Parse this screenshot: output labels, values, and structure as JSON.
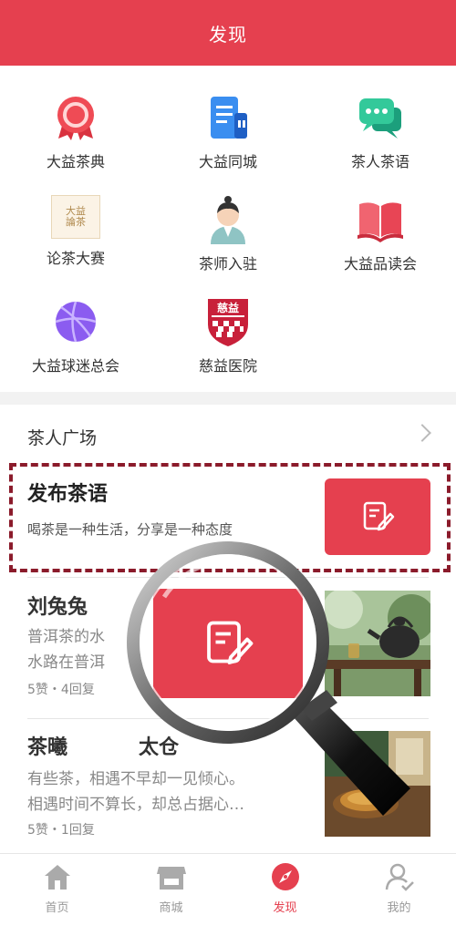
{
  "header": {
    "title": "发现"
  },
  "grid": {
    "items": [
      {
        "label": "大益茶典",
        "icon": "medal-icon"
      },
      {
        "label": "大益同城",
        "icon": "building-icon"
      },
      {
        "label": "茶人茶语",
        "icon": "chat-bubble-icon"
      },
      {
        "label": "论茶大赛",
        "icon": "tea-contest-logo-icon"
      },
      {
        "label": "茶师入驻",
        "icon": "tea-master-avatar-icon"
      },
      {
        "label": "大益品读会",
        "icon": "open-book-icon"
      },
      {
        "label": "大益球迷总会",
        "icon": "basketball-icon"
      },
      {
        "label": "慈益医院",
        "icon": "hospital-shield-icon"
      }
    ],
    "contest_logo_text": "大益論茶",
    "hospital_badge_text": "慈益"
  },
  "square": {
    "title": "茶人广场"
  },
  "publish": {
    "title": "发布茶语",
    "subtitle": "喝茶是一种生活，分享是一种态度"
  },
  "posts": [
    {
      "author": "刘兔兔",
      "lines": [
        "普洱茶的水",
        "水路在普洱"
      ],
      "meta": "5赞・4回复"
    },
    {
      "author": "茶曦",
      "author_extra": "太仓",
      "lines": [
        "有些茶，相遇不早却一见倾心。",
        "相遇时间不算长，却总占据心…"
      ],
      "meta": "5赞・1回复"
    }
  ],
  "tabbar": {
    "items": [
      {
        "label": "首页",
        "icon": "home-icon"
      },
      {
        "label": "商城",
        "icon": "shop-icon"
      },
      {
        "label": "发现",
        "icon": "compass-icon",
        "active": true
      },
      {
        "label": "我的",
        "icon": "user-icon"
      }
    ]
  },
  "colors": {
    "brand": "#e5404f",
    "highlight_border": "#8b1b2b"
  }
}
